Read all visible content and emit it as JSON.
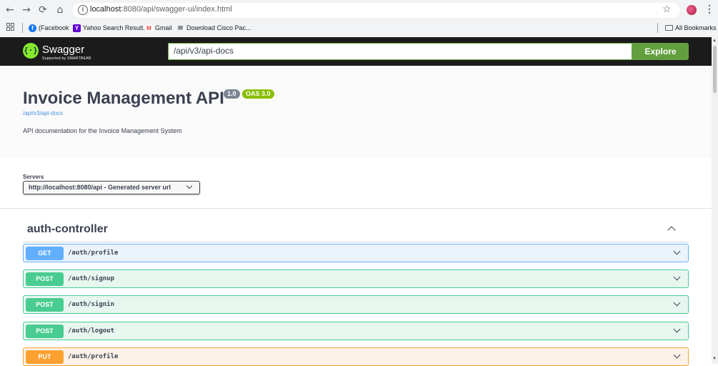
{
  "browser": {
    "url_host": "localhost",
    "url_path": ":8080/api/swagger-ui/index.html",
    "bookmarks": [
      {
        "label": "(Facebook",
        "color": "#1877f2",
        "glyph": "f"
      },
      {
        "label": "Yahoo Search Result...",
        "color": "#6001d2",
        "glyph": "Y"
      },
      {
        "label": "Gmail",
        "color": "#ea4335",
        "glyph": "M"
      },
      {
        "label": "Download Cisco Pac...",
        "color": "#5f6368",
        "glyph": "≋"
      }
    ],
    "all_bookmarks": "All Bookmarks"
  },
  "topbar": {
    "logo_text": "Swagger",
    "logo_sub": "Supported by SMARTBEAR",
    "explore_value": "/api/v3/api-docs",
    "explore_label": "Explore"
  },
  "info": {
    "title": "Invoice Management API",
    "version": "1.0",
    "oas": "OAS 3.0",
    "link": "/api/v3/api-docs",
    "description": "API documentation for the Invoice Management System"
  },
  "servers": {
    "label": "Servers",
    "selected": "http://localhost:8080/api - Generated server url"
  },
  "tag": {
    "name": "auth-controller",
    "operations": [
      {
        "method": "GET",
        "path": "/auth/profile"
      },
      {
        "method": "POST",
        "path": "/auth/signup"
      },
      {
        "method": "POST",
        "path": "/auth/signin"
      },
      {
        "method": "POST",
        "path": "/auth/logout"
      },
      {
        "method": "PUT",
        "path": "/auth/profile"
      }
    ]
  },
  "colors": {
    "get": "#61affe",
    "post": "#49cc90",
    "put": "#fca130",
    "explore": "#62a03f",
    "oas_badge": "#89bf04"
  }
}
